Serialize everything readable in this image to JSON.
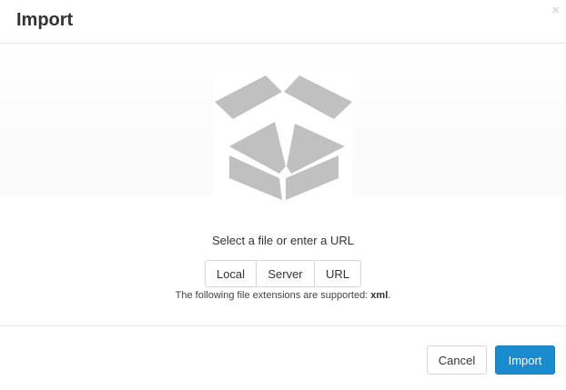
{
  "dialog": {
    "title": "Import",
    "close_symbol": "×",
    "close_icon": "close-icon"
  },
  "drop_area": {
    "icon": "open-box-icon",
    "prompt": "Select a file or enter a URL"
  },
  "source_options": [
    {
      "label": "Local"
    },
    {
      "label": "Server"
    },
    {
      "label": "URL"
    }
  ],
  "extensions_note": {
    "prefix": "The following file extensions are supported: ",
    "extensions": "xml",
    "suffix": "."
  },
  "footer": {
    "cancel_label": "Cancel",
    "import_label": "Import"
  },
  "colors": {
    "primary": "#1b8bd0",
    "icon_gray": "#c0c0c0"
  }
}
